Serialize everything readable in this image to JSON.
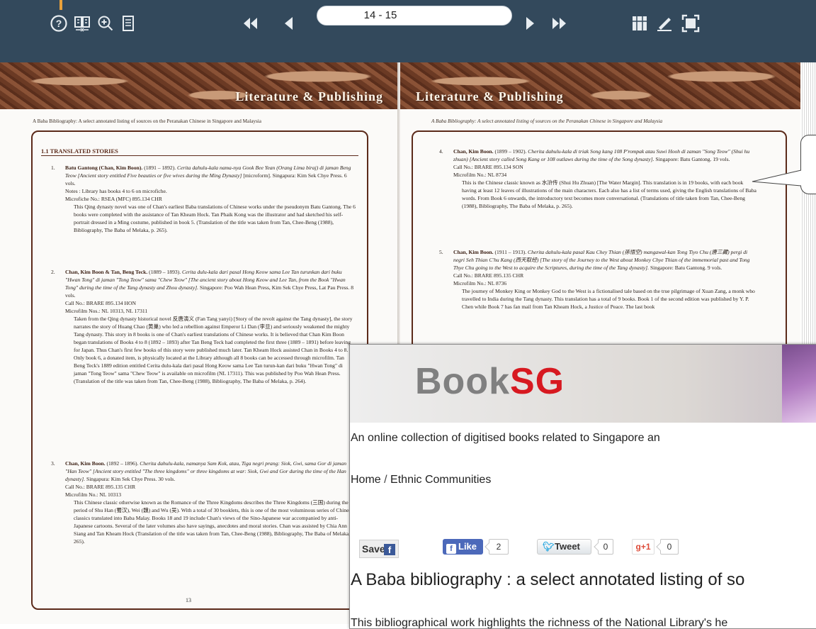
{
  "toolbar": {
    "page_range": "14 - 15",
    "icons": [
      "help-icon",
      "thumbnails-icon",
      "zoom-in-icon",
      "notes-icon",
      "first-page-icon",
      "previous-page-icon",
      "next-page-icon",
      "last-page-icon",
      "bookshelf-icon",
      "annotate-icon",
      "fullscreen-icon"
    ],
    "colors": {
      "bar": "#33495c",
      "icon": "#e8edf1"
    }
  },
  "left_page": {
    "banner_title": "Literature & Publishing",
    "subtitle": "A Baba Bibliography: A select annotated listing of sources on the Peranakan Chinese in Singapore and Malaysia",
    "section_heading": "1.1 TRANSLATED STORIES",
    "page_number": "13",
    "entries": [
      {
        "num": "1.",
        "head": "Batu Gantong (Chan, Kim Boon).",
        "years": "(1891 – 1892).",
        "italic": "Cerita dahulu-kala nama-nya Gook Bee Yean (Orang Lima biraj) di jaman Beng Teow [Ancient story entitled Five beauties or five wives during the Ming Dynasty]",
        "pub": "[microform]. Singapura: Kim Sek Chye Press. 6 vols.",
        "notes": "Notes : Library has books 4 to 6 on microfiche.",
        "call": "Microfiche No.: RSEA (MFC) 895.134 CHR",
        "desc": "This Qing dynasty novel was one of Chan's earliest Baba translations of Chinese works under the pseudonym Batu Gantong. The 6 books were completed with the assistance of Tan Kheam Hock. Tan Phaik Kong was the illustrator and had sketched his self-portrait dressed in a Ming costume, published in book 5. (Translation of the title was taken from Tan, Chee-Beng (1988), Bibliography, The Baba of Melaka, p. 265)."
      },
      {
        "num": "2.",
        "head": "Chan, Kim Boon & Tan, Beng Teck.",
        "years": "(1889 – 1893).",
        "italic": "Cerita dulu-kala dari pasal Hong Keow sama Lee Tan turunkan dari buku \"Hwan Tong\" di jaman \"Tong Teow\" sama \"Chew Teow\" [The ancient story about Hong Keow and Lee Tan, from the Book \"Hwan Tong\" during the time of the Tang dynasty and Zhou dynasty].",
        "pub": "Singapore: Poo Wah Hean Press, Kim Sek Chye Press, Lat Pau Press. 8 vols.",
        "notes": "Call No.: BRARE 895.134 HON",
        "call": "Microfilm Nos.: NL 10313, NL 17311",
        "desc": "Taken from the Qing dynasty historical novel 反唐演义 (Fan Tang yanyi) [Story of the revolt against the Tang dynasty], the story narrates the story of Huang Chao (黄巢) who led a rebellion against Emperor Li Dan (李旦) and seriously weakened the mighty Tang dynasty. This story in 8 books is one of Chan's earliest translations of Chinese works. It is believed that Chan Kim Boon began translations of Books 4 to 8 (1892 – 1893) after Tan Beng Teck had completed the first three (1889 – 1891) before leaving for Japan. Thus Chan's first few books of this story were published much later. Tan Kheam Hock assisted Chan in Books 4 to 8. Only book 6, a donated item, is physically located at the Library although all 8 books can be accessed through microfilm. Tan Beng Teck's 1889 edition entitled Cerita dulu-kala dari pasal Hong Keow sama Lee Tan turun-kan dari buku \"Hwan Tong\" di jaman \"Tong Teow\" sama \"Chew Teow\" is available on microfilm (NL 17311). This was published by Poo Wah Hean Press. (Translation of the title was taken from Tan, Chee-Beng (1988), Bibliography, The Baba of Melaka, p. 264)."
      },
      {
        "num": "3.",
        "head": "Chan, Kim Boon.",
        "years": "(1892 – 1896).",
        "italic": "Cherita dahulu-kala, namanya Sam Kok, atau, Tiga negri prang: Siok, Gwi, sama Gor di jaman \"Han Teow\" [Ancient story entitled \"The three kingdoms\" or three kingdoms at war: Siok, Gwi and Gor during the time of the Han dynasty].",
        "pub": "Singapura: Kim Sek Chye Press. 30 vols.",
        "notes": "Call No.: BRARE 895.135 CHR",
        "call": "Microfilm No.: NL 10313",
        "desc": "This Chinese classic otherwise known as the Romance of the Three Kingdoms describes the Three Kingdoms (三国) during the period of Shu Han (蜀汉), Wei (魏) and Wu (吴). With a total of 30 booklets, this is one of the most voluminous series of Chinese classics translated into Baba Malay. Books 18 and 19 include Chan's views of the Sino-Japanese war accompanied by anti-Japanese cartoons. Several of the later volumes also have sayings, anecdotes and moral stories. Chan was assisted by Chia Ann Siang and Tan Kheam Hock (Translation of the title was taken from Tan, Chee-Beng (1988), Bibliography, The Baba of Melaka, p. 265)."
      }
    ]
  },
  "right_page": {
    "banner_title": "Literature & Publishing",
    "subtitle": "A Baba Bibliography: A select annotated listing of sources on the Peranakan Chinese in Singapore and Malaysia",
    "entries": [
      {
        "num": "4.",
        "head": "Chan, Kim Boon.",
        "years": "(1899 – 1902).",
        "italic": "Cherita dahulu-kala di triak Song kang 108 P'rompak atau Suwi Hooh di zaman \"Song Teow\" (Shui hu zhuan) [Ancient story called Song Kang or 108 outlaws during the time of the Song dynasty].",
        "pub": "Singapore: Batu Gantong. 19 vols.",
        "notes": "Call No.: BRARE 895.134 SON",
        "call": "Microfilm No.: NL 8734",
        "desc": "This is the Chinese classic known as 水浒传 (Shui Hu Zhuan) [The Water Margin]. This translation is in 19 books, with each book having at least 12 leaves of illustrations of the main characters. Each also has a list of terms used, giving the English translations of Baba words. From Book 6 onwards, the introductory text becomes more conversational. (Translations of title taken from Tan, Chee-Beng (1988), Bibliography, The Baba of Melaka, p. 265)."
      },
      {
        "num": "5.",
        "head": "Chan, Kim Boon.",
        "years": "(1911 – 1913).",
        "italic": "Cherita dahulu-kala pasal Kau Chey Thian (孫悟空) mangawal-kan Tong Tiyo Chu (唐三藏) pergi di negri Seh Thian C'hu Kang (西天取经) [The story of the Journey to the West about Monkey Chye Thian of the immemorial past and Tong Thye Chu going to the West to acquire the Scriptures, during the time of the Tang dynasty].",
        "pub": "Singapore: Batu Gantong. 9 vols.",
        "notes": "Call No.: BRARE 895.135 CHR",
        "call": "Microfilm No.: NL 8736",
        "desc": "The journey of Monkey King or Monkey God to the West is a fictionalised tale based on the true pilgrimage of Xuan Zang, a monk who travelled to India during the Tang dynasty. This translation has a total of 9 books. Book 1 of the second edition was published by Y. P. Chen while Book 7 has fan mail from Tan Kheam Hock, a Justice of Peace. The last book"
      }
    ]
  },
  "booksg": {
    "logo_book": "Book",
    "logo_sg": "SG",
    "tagline": "An online collection of digitised books related to Singapore an",
    "breadcrumb": {
      "home": "Home",
      "sep": "/",
      "current": "Ethnic Communities"
    },
    "save_label": "Save",
    "like_label": "Like",
    "like_count": "2",
    "tweet_label": "Tweet",
    "tweet_count": "0",
    "gplus_label": "g+1",
    "gplus_count": "0",
    "title": "A Baba bibliography : a select annotated listing of so",
    "description": "This bibliographical work highlights the richness of the National Library's he",
    "colors": {
      "sg": "#d71920",
      "book": "#808080",
      "facebook": "#4c69ba",
      "twitter": "#2ba9e1",
      "gplus": "#dd4b39"
    }
  }
}
